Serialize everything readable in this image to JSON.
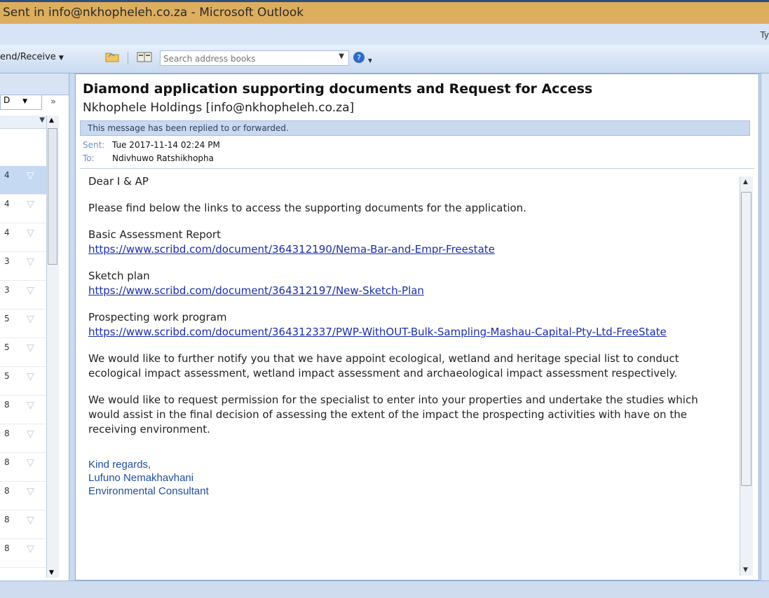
{
  "window": {
    "title": "Sent in info@nkhopheleh.co.za - Microsoft Outlook"
  },
  "menubar": {
    "type_question_stub": "Ty"
  },
  "toolbar": {
    "send_receive_label": "end/Receive",
    "search_placeholder": "Search address books"
  },
  "message_list": {
    "combo_value": "D",
    "rows": [
      {
        "num": "4",
        "selected": true
      },
      {
        "num": "4"
      },
      {
        "num": "4"
      },
      {
        "num": "3"
      },
      {
        "num": "3"
      },
      {
        "num": "5"
      },
      {
        "num": "5"
      },
      {
        "num": "5"
      },
      {
        "num": "8"
      },
      {
        "num": "8"
      },
      {
        "num": "8"
      },
      {
        "num": "8"
      },
      {
        "num": "8"
      },
      {
        "num": "8"
      }
    ]
  },
  "email": {
    "subject": "Diamond application supporting documents and Request for Access",
    "from": "Nkhophele Holdings [info@nkhopheleh.co.za]",
    "infobar": "This message has been replied to or forwarded.",
    "sent_label": "Sent:",
    "sent_value": "Tue 2017-11-14 02:24 PM",
    "to_label": "To:",
    "to_value": "Ndivhuwo Ratshikhopha",
    "greeting": "Dear I & AP",
    "intro": "Please  find below the links to access the supporting documents for the application.",
    "doc1_title": "Basic Assessment Report",
    "doc1_link": "https://www.scribd.com/document/364312190/Nema-Bar-and-Empr-Freestate",
    "doc2_title": "Sketch plan",
    "doc2_link": "https://www.scribd.com/document/364312197/New-Sketch-Plan",
    "doc3_title": "Prospecting work program",
    "doc3_link": "https://www.scribd.com/document/364312337/PWP-WithOUT-Bulk-Sampling-Mashau-Capital-Pty-Ltd-FreeState",
    "para_notify": "We would like to further notify you that we have appoint ecological, wetland and heritage special list to conduct ecological impact assessment, wetland impact assessment and archaeological impact assessment respectively.",
    "para_request": "We would like to request permission for the specialist to enter into your properties and undertake the studies which would assist in the final decision of assessing the extent of the impact the prospecting activities with have on the receiving environment.",
    "sig_closing": "Kind regards,",
    "sig_name": "Lufuno Nemakhavhani",
    "sig_role": "Environmental Consultant"
  }
}
